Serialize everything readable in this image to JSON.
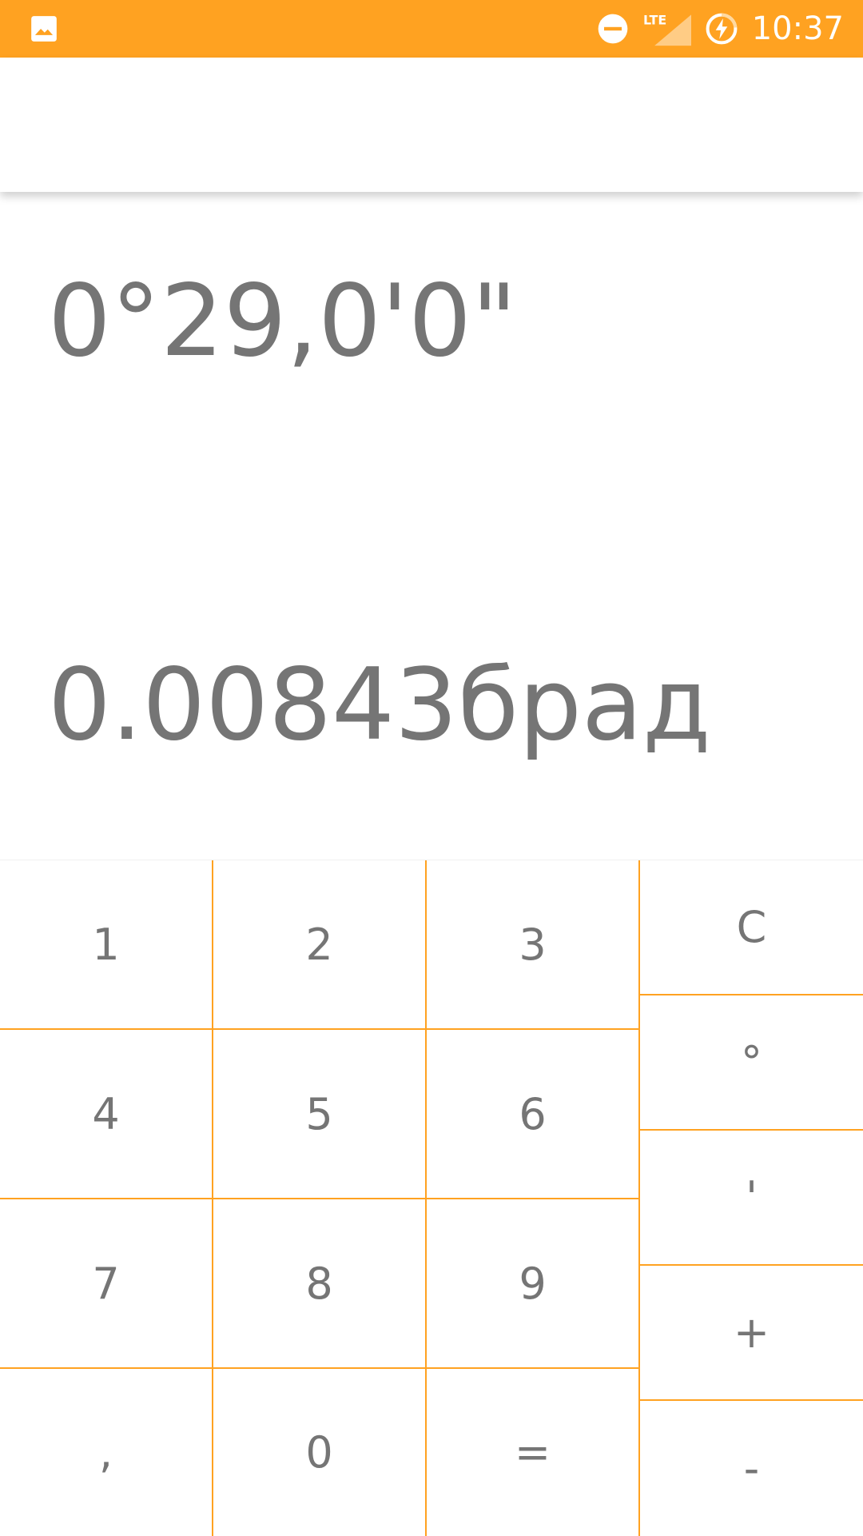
{
  "status_bar": {
    "background": "#ffa221",
    "left_icon": "image-icon",
    "icons": [
      "do-not-disturb-icon",
      "lte-signal-icon",
      "battery-charging-icon"
    ],
    "lte_label": "LTE",
    "time": "10:37"
  },
  "display": {
    "degrees_value": "0°29,0'0\"",
    "radians_value": "0.00843брад"
  },
  "keypad": {
    "accent": "#ffa221",
    "text_color": "#757575",
    "digits": [
      [
        "1",
        "2",
        "3"
      ],
      [
        "4",
        "5",
        "6"
      ],
      [
        "7",
        "8",
        "9"
      ],
      [
        ",",
        "0",
        "="
      ]
    ],
    "side": [
      "C",
      "°",
      "'",
      "+",
      "-"
    ]
  }
}
